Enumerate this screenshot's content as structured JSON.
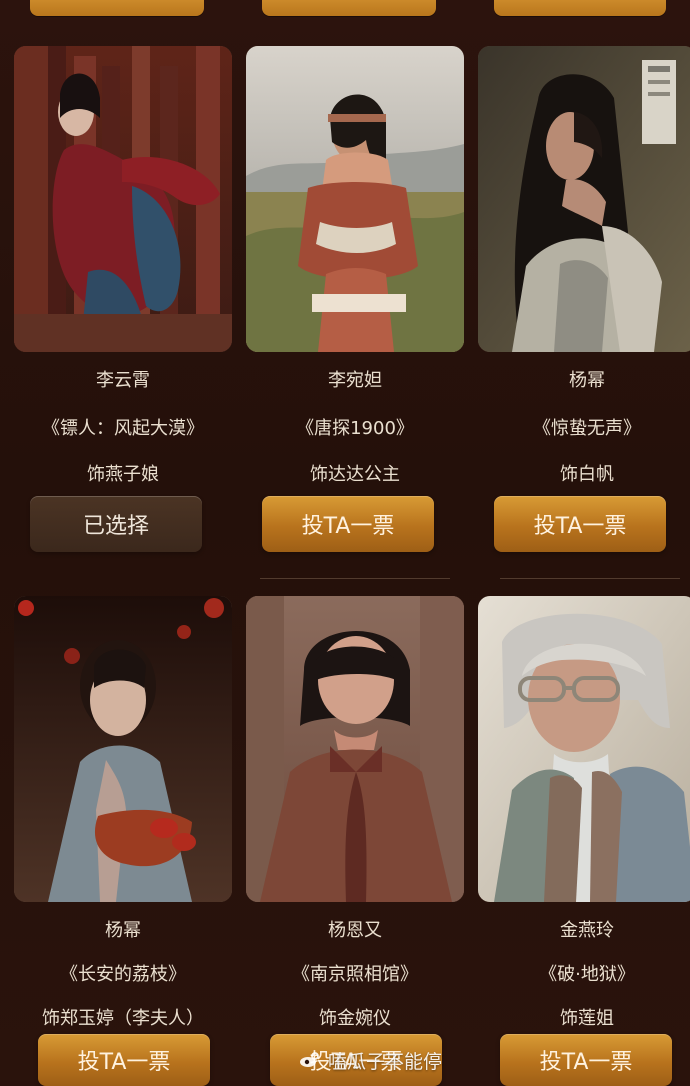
{
  "cards": [
    {
      "name": "李云霄",
      "movie": "《镖人：风起大漠》",
      "role": "饰燕子娘",
      "button": "已选择"
    },
    {
      "name": "李宛妲",
      "movie": "《唐探1900》",
      "role": "饰达达公主",
      "button": "投TA一票"
    },
    {
      "name": "杨幂",
      "movie": "《惊蛰无声》",
      "role": "饰白帆",
      "button": "投TA一票"
    },
    {
      "name": "杨幂",
      "movie": "《长安的荔枝》",
      "role": "饰郑玉婷（李夫人）",
      "button": "投TA一票"
    },
    {
      "name": "杨恩又",
      "movie": "《南京照相馆》",
      "role": "饰金婉仪",
      "button": "投TA一票"
    },
    {
      "name": "金燕玲",
      "movie": "《破·地狱》",
      "role": "饰莲姐",
      "button": "投TA一票"
    }
  ],
  "watermark": {
    "text": "嗑瓜子不能停"
  },
  "icons": {
    "weibo": "weibo-icon"
  },
  "colors": {
    "background": "#2a120c",
    "button_gold": "#c7832a",
    "selected_button": "#433021",
    "text": "#eadfcf"
  }
}
